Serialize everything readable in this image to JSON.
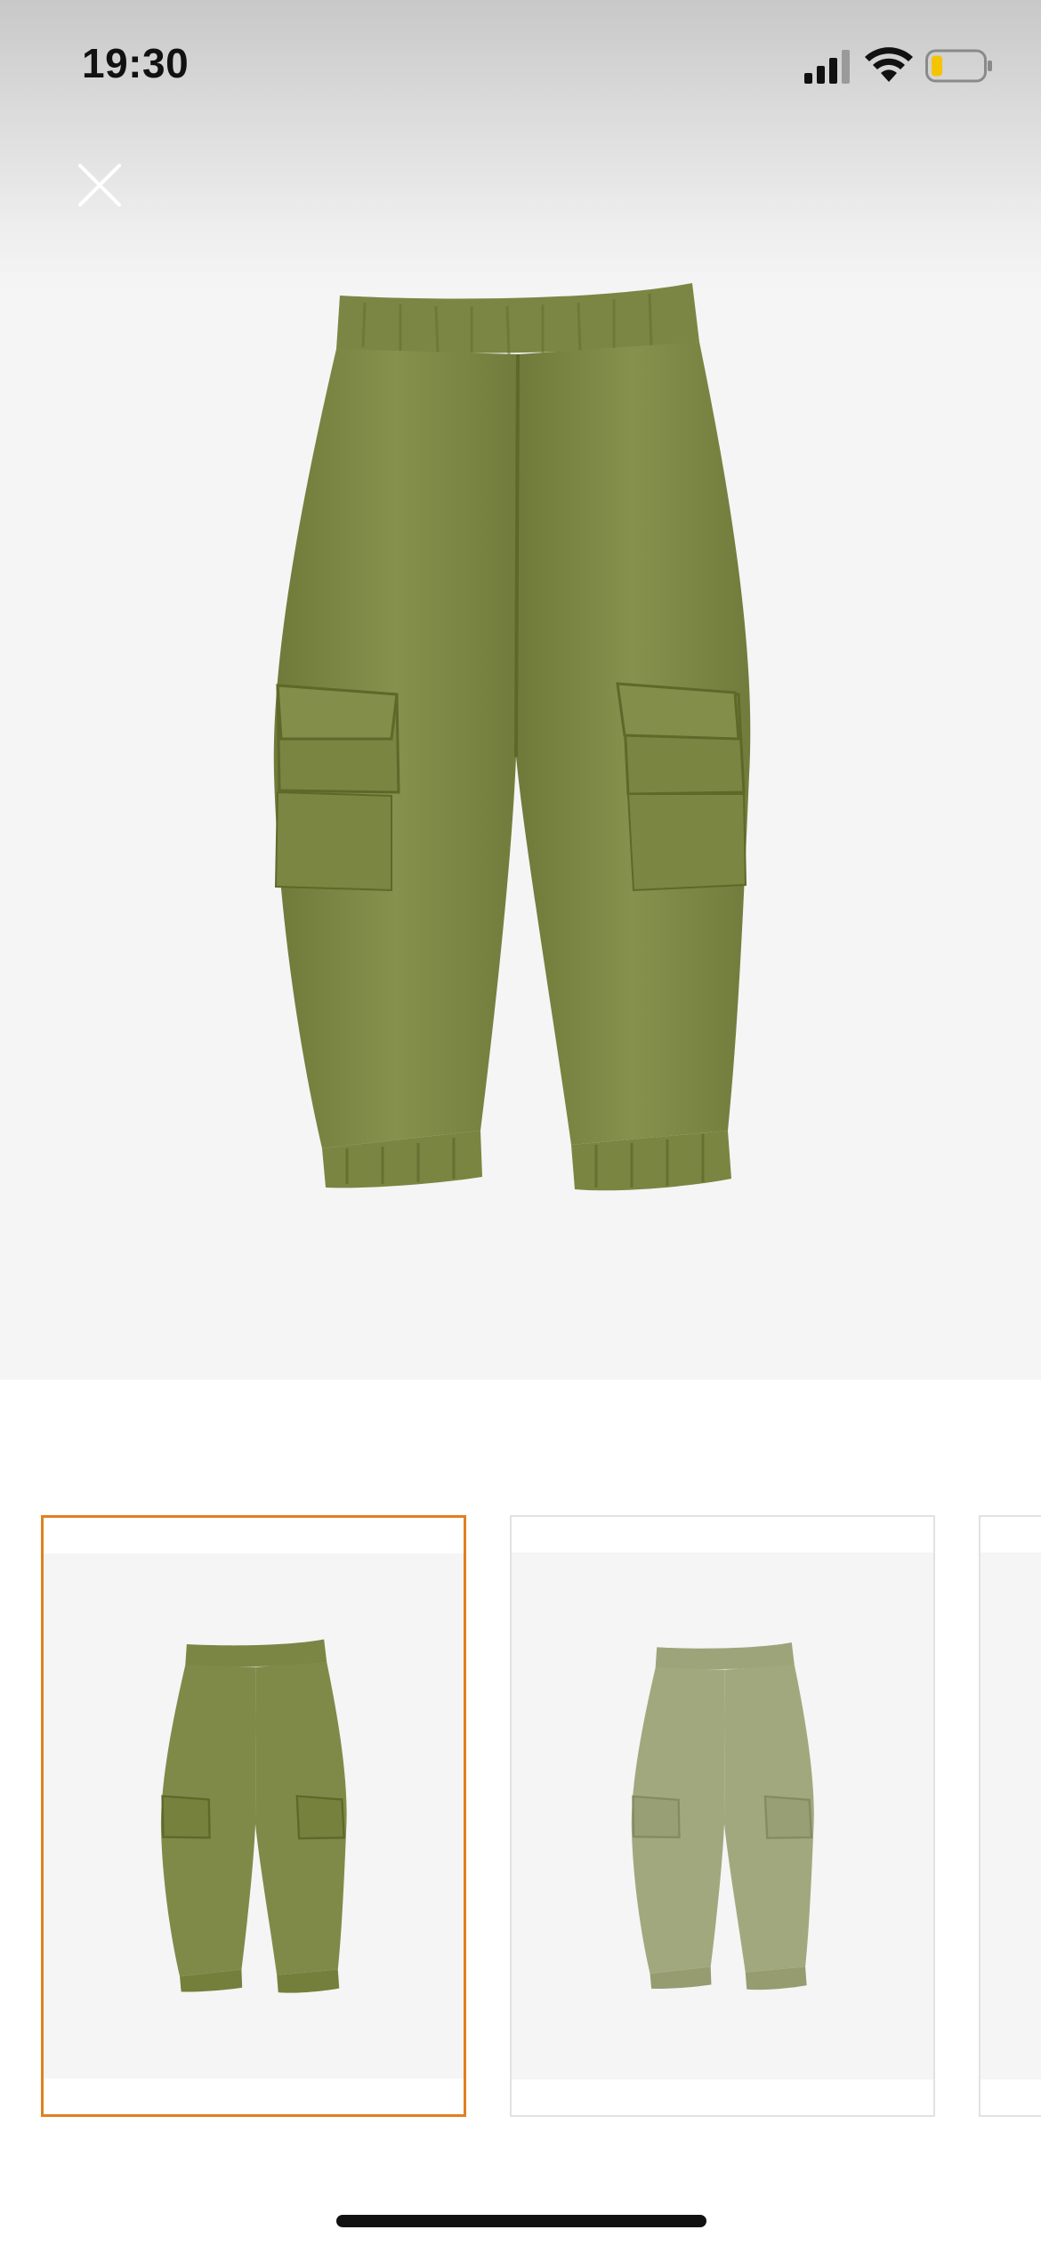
{
  "status_bar": {
    "time": "19:30",
    "icons": [
      "signal-icon",
      "wifi-icon",
      "battery-icon"
    ],
    "battery_accent": "#f5c400"
  },
  "viewer": {
    "close_icon": "close-icon",
    "main_image": "olive-cargo-pants"
  },
  "thumbnails": [
    {
      "image": "olive-cargo-pants",
      "selected": true,
      "color": "#7f8a48"
    },
    {
      "image": "sage-cargo-pants",
      "selected": false,
      "color": "#a2a87e"
    },
    {
      "image": "partial-thumbnail",
      "selected": false
    }
  ],
  "colors": {
    "selected_border": "#e0801f",
    "background": "#f5f5f5"
  }
}
